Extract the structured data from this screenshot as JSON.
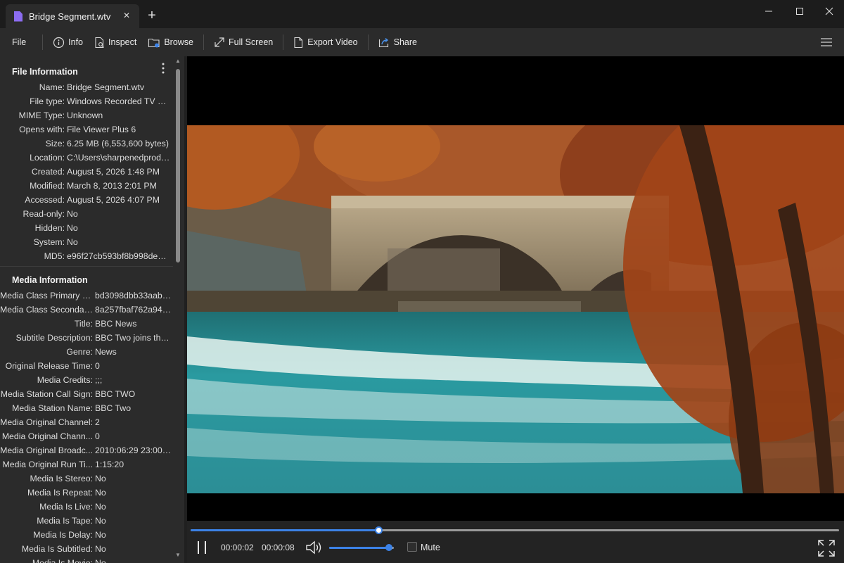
{
  "window": {
    "tab_title": "Bridge Segment.wtv",
    "tab_close_glyph": "✕",
    "new_tab_glyph": "+"
  },
  "toolbar": {
    "file_label": "File",
    "info_label": "Info",
    "inspect_label": "Inspect",
    "browse_label": "Browse",
    "fullscreen_label": "Full Screen",
    "export_label": "Export Video",
    "share_label": "Share"
  },
  "file_info": {
    "title": "File Information",
    "rows": [
      {
        "label": "Name:",
        "value": "Bridge Segment.wtv"
      },
      {
        "label": "File type:",
        "value": "Windows Recorded TV Sh..."
      },
      {
        "label": "MIME Type:",
        "value": "Unknown"
      },
      {
        "label": "Opens with:",
        "value": "File Viewer Plus 6"
      },
      {
        "label": "Size:",
        "value": "6.25 MB (6,553,600 bytes)"
      },
      {
        "label": "Location:",
        "value": "C:\\Users\\sharpenedprodu..."
      },
      {
        "label": "Created:",
        "value": "August 5, 2026 1:48 PM"
      },
      {
        "label": "Modified:",
        "value": "March 8, 2013 2:01 PM"
      },
      {
        "label": "Accessed:",
        "value": "August 5, 2026 4:07 PM"
      },
      {
        "label": "Read-only:",
        "value": "No"
      },
      {
        "label": "Hidden:",
        "value": "No"
      },
      {
        "label": "System:",
        "value": "No"
      },
      {
        "label": "MD5:",
        "value": "e96f27cb593bf8b998de817..."
      }
    ]
  },
  "media_info": {
    "title": "Media Information",
    "rows": [
      {
        "label": "Media Class Primary ID:",
        "value": "bd3098dbb33aab4..."
      },
      {
        "label": "Media Class Secondary...",
        "value": "8a257fbaf762a947..."
      },
      {
        "label": "Title:",
        "value": "BBC News"
      },
      {
        "label": "Subtitle Description:",
        "value": "BBC Two joins the..."
      },
      {
        "label": "Genre:",
        "value": "News"
      },
      {
        "label": "Original Release Time:",
        "value": "0"
      },
      {
        "label": "Media Credits:",
        "value": ";;;"
      },
      {
        "label": "Media Station Call Sign:",
        "value": "BBC TWO"
      },
      {
        "label": "Media Station Name:",
        "value": "BBC Two"
      },
      {
        "label": "Media Original Channel:",
        "value": "2"
      },
      {
        "label": "Media Original Chann...",
        "value": "0"
      },
      {
        "label": "Media Original Broadc...",
        "value": "2010:06:29 23:00:00Z"
      },
      {
        "label": "Media Original Run Ti...",
        "value": "1:15:20"
      },
      {
        "label": "Media Is Stereo:",
        "value": "No"
      },
      {
        "label": "Media Is Repeat:",
        "value": "No"
      },
      {
        "label": "Media Is Live:",
        "value": "No"
      },
      {
        "label": "Media Is Tape:",
        "value": "No"
      },
      {
        "label": "Media Is Delay:",
        "value": "No"
      },
      {
        "label": "Media Is Subtitled:",
        "value": "No"
      },
      {
        "label": "Media Is Movie:",
        "value": "No"
      }
    ]
  },
  "player": {
    "current_time": "00:00:02",
    "duration": "00:00:08",
    "progress": 0.29,
    "volume": 0.92,
    "mute_label": "Mute",
    "muted": false
  },
  "colors": {
    "accent": "#3c82e6",
    "file_icon": "#8b6cf0"
  }
}
